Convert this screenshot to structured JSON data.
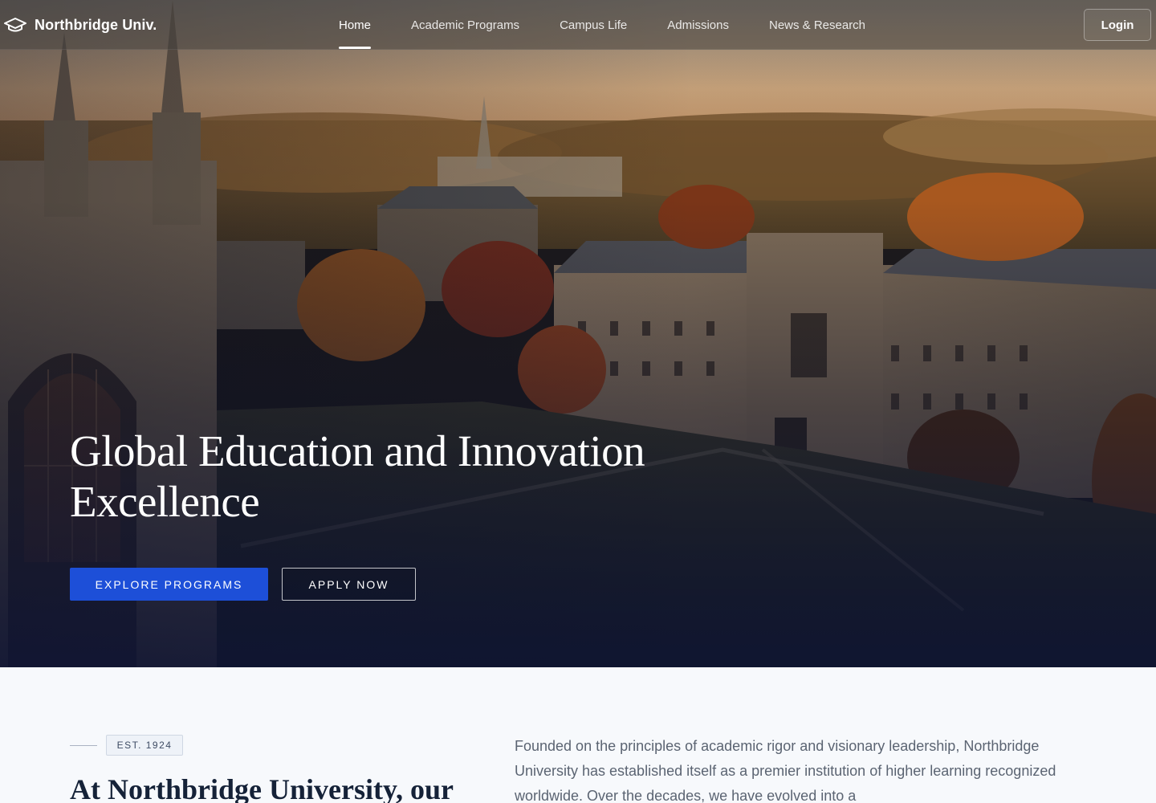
{
  "brand": {
    "name": "Northbridge Univ.",
    "icon": "graduation-cap-icon"
  },
  "nav": {
    "links": [
      {
        "label": "Home",
        "active": true
      },
      {
        "label": "Academic Programs",
        "active": false
      },
      {
        "label": "Campus Life",
        "active": false
      },
      {
        "label": "Admissions",
        "active": false
      },
      {
        "label": "News & Research",
        "active": false
      }
    ],
    "login_label": "Login"
  },
  "hero": {
    "title": "Global Education and Innovation Excellence",
    "primary_cta": "EXPLORE PROGRAMS",
    "secondary_cta": "APPLY NOW"
  },
  "about": {
    "badge": "EST. 1924",
    "heading": "At Northbridge University, our",
    "paragraph": "Founded on the principles of academic rigor and visionary leadership, Northbridge University has established itself as a premier institution of higher learning recognized worldwide. Over the decades, we have evolved into a"
  },
  "colors": {
    "accent": "#1d4fd8",
    "heading": "#152238",
    "body_text": "#5b6472",
    "nav_bg": "#46423e"
  }
}
